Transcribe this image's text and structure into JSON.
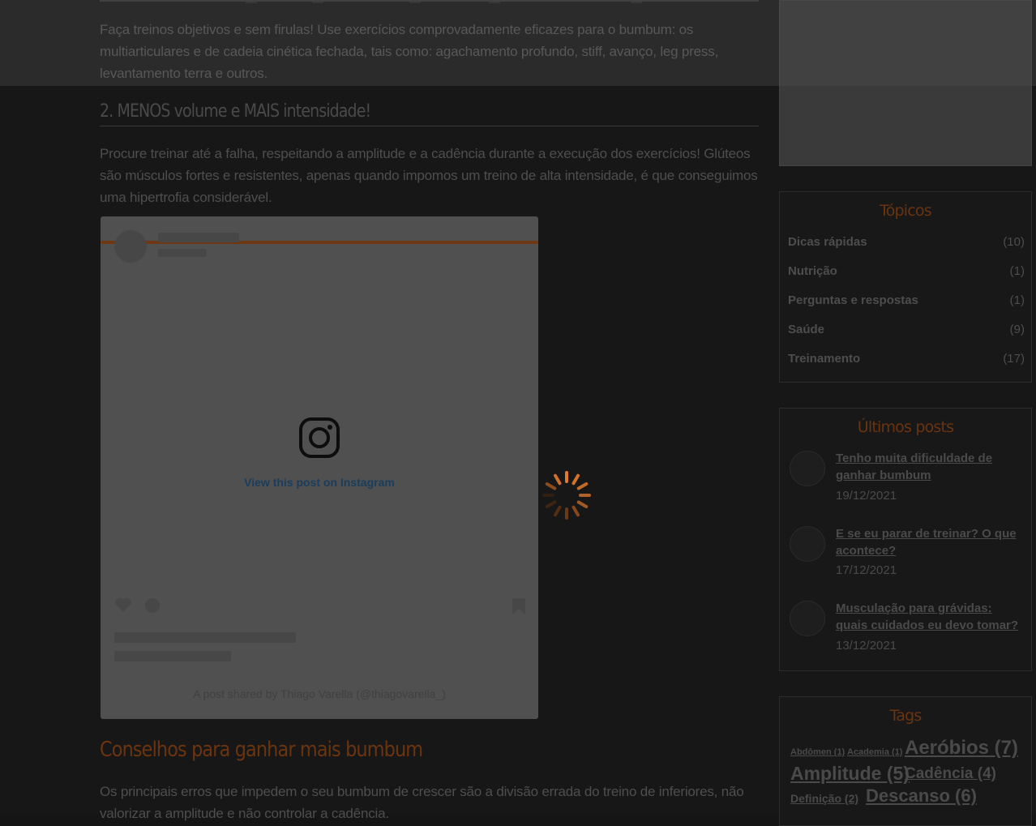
{
  "article": {
    "intro_paragraph": "Faça treinos objetivos e sem firulas! Use exercícios comprovadamente eficazes para o bumbum: os multiarticulares e de cadeia cinética fechada, tais como: agachamento profundo, stiff, avanço, leg press, levantamento terra e outros.",
    "section_heading": "2. MENOS volume e MAIS intensidade!",
    "section_paragraph": "Procure treinar até a falha, respeitando a amplitude e a cadência durante a execução dos exercícios! Glúteos são músculos fortes e resistentes, apenas quando impomos um treino de alta intensidade, é que conseguimos uma hipertrofia considerável.",
    "embed": {
      "link_text": "View this post on Instagram",
      "caption": "A post shared by Thiago Varella (@thiagovarella_)"
    },
    "next_heading": "Conselhos para ganhar mais bumbum",
    "next_paragraph": "Os principais erros que impedem o seu bumbum de crescer são a divisão errada do treino de inferiores,  não valorizar a amplitude e não controlar a cadência."
  },
  "sidebar": {
    "topics": {
      "title": "Tópicos",
      "items": [
        {
          "label": "Dicas rápidas",
          "count": "(10)"
        },
        {
          "label": "Nutrição",
          "count": "(1)"
        },
        {
          "label": "Perguntas e respostas",
          "count": "(1)"
        },
        {
          "label": "Saúde",
          "count": "(9)"
        },
        {
          "label": "Treinamento",
          "count": "(17)"
        }
      ]
    },
    "latest_posts": {
      "title": "Últimos posts",
      "items": [
        {
          "title": "Tenho muita dificuldade de ganhar bumbum",
          "date": "19/12/2021"
        },
        {
          "title": "E se eu parar de treinar? O que acontece?",
          "date": "17/12/2021"
        },
        {
          "title": "Musculação para grávidas: quais cuidados eu devo tomar?",
          "date": "13/12/2021"
        }
      ]
    },
    "tags": {
      "title": "Tags",
      "items": [
        {
          "label": "Abdômen (1)"
        },
        {
          "label": "Academia (1)"
        },
        {
          "label": "Aeróbios (7)"
        },
        {
          "label": "Amplitude (5)"
        },
        {
          "label": "Cadência (4)"
        },
        {
          "label": "Definição (2)"
        },
        {
          "label": "Descanso (6)"
        }
      ]
    }
  },
  "colors": {
    "accent": "#6a3410",
    "spinner": "#e27a2e",
    "overlay": "#151515"
  },
  "icons": {
    "instagram": "instagram-icon",
    "spinner": "loading-spinner-icon"
  }
}
